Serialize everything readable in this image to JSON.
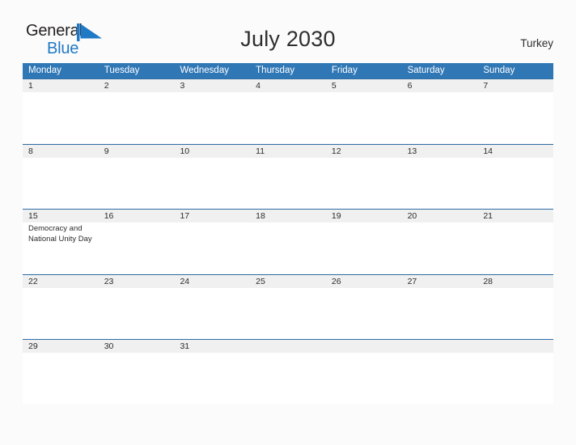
{
  "brand": {
    "name_part1": "General",
    "name_part2": "Blue",
    "flag_icon": "blue-triangle-flag-icon",
    "color_dark": "#231f20",
    "color_blue": "#1f79c4"
  },
  "header": {
    "title": "July 2030",
    "country": "Turkey"
  },
  "colors": {
    "header_blue": "#3077b5",
    "band_gray": "#f0f0f0",
    "band_border": "#2e6da4",
    "page_background": "#fbfbfb",
    "calendar_background": "#ffffff",
    "text": "#2b2b2b"
  },
  "calendar": {
    "month": "July",
    "year": "2030",
    "weekdays": [
      "Monday",
      "Tuesday",
      "Wednesday",
      "Thursday",
      "Friday",
      "Saturday",
      "Sunday"
    ],
    "weeks": [
      {
        "days": [
          {
            "date": "1",
            "event": ""
          },
          {
            "date": "2",
            "event": ""
          },
          {
            "date": "3",
            "event": ""
          },
          {
            "date": "4",
            "event": ""
          },
          {
            "date": "5",
            "event": ""
          },
          {
            "date": "6",
            "event": ""
          },
          {
            "date": "7",
            "event": ""
          }
        ]
      },
      {
        "days": [
          {
            "date": "8",
            "event": ""
          },
          {
            "date": "9",
            "event": ""
          },
          {
            "date": "10",
            "event": ""
          },
          {
            "date": "11",
            "event": ""
          },
          {
            "date": "12",
            "event": ""
          },
          {
            "date": "13",
            "event": ""
          },
          {
            "date": "14",
            "event": ""
          }
        ]
      },
      {
        "days": [
          {
            "date": "15",
            "event": "Democracy and National Unity Day"
          },
          {
            "date": "16",
            "event": ""
          },
          {
            "date": "17",
            "event": ""
          },
          {
            "date": "18",
            "event": ""
          },
          {
            "date": "19",
            "event": ""
          },
          {
            "date": "20",
            "event": ""
          },
          {
            "date": "21",
            "event": ""
          }
        ]
      },
      {
        "days": [
          {
            "date": "22",
            "event": ""
          },
          {
            "date": "23",
            "event": ""
          },
          {
            "date": "24",
            "event": ""
          },
          {
            "date": "25",
            "event": ""
          },
          {
            "date": "26",
            "event": ""
          },
          {
            "date": "27",
            "event": ""
          },
          {
            "date": "28",
            "event": ""
          }
        ]
      },
      {
        "days": [
          {
            "date": "29",
            "event": ""
          },
          {
            "date": "30",
            "event": ""
          },
          {
            "date": "31",
            "event": ""
          },
          {
            "date": "",
            "event": ""
          },
          {
            "date": "",
            "event": ""
          },
          {
            "date": "",
            "event": ""
          },
          {
            "date": "",
            "event": ""
          }
        ]
      }
    ]
  }
}
